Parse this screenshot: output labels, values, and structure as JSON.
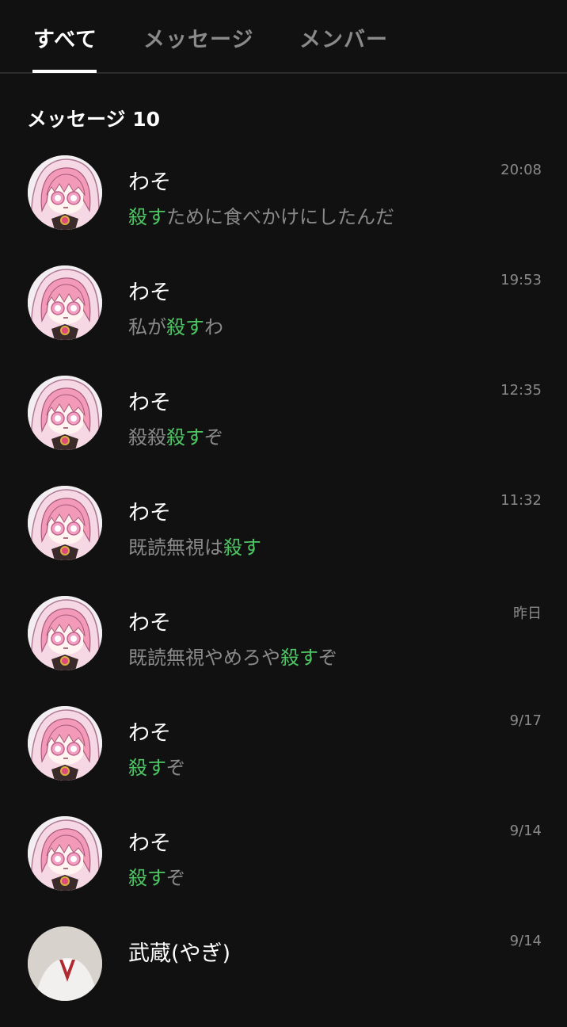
{
  "tabs": [
    {
      "label": "すべて",
      "active": true
    },
    {
      "label": "メッセージ",
      "active": false
    },
    {
      "label": "メンバー",
      "active": false
    }
  ],
  "section": {
    "title": "メッセージ 10"
  },
  "colors": {
    "background": "#111111",
    "highlight": "#4cc764",
    "muted": "#8a8a8a",
    "text": "#ffffff"
  },
  "messages": [
    {
      "name": "わそ",
      "time": "20:08",
      "pre": "",
      "hl": "殺す",
      "post": "ために食べかけにしたんだ",
      "avatar_icon": "pink-hood-character-avatar"
    },
    {
      "name": "わそ",
      "time": "19:53",
      "pre": "私が",
      "hl": "殺す",
      "post": "わ",
      "avatar_icon": "pink-hood-character-avatar"
    },
    {
      "name": "わそ",
      "time": "12:35",
      "pre": "殺殺",
      "hl": "殺す",
      "post": "ぞ",
      "avatar_icon": "pink-hood-character-avatar"
    },
    {
      "name": "わそ",
      "time": "11:32",
      "pre": "既読無視は",
      "hl": "殺す",
      "post": "",
      "avatar_icon": "pink-hood-character-avatar"
    },
    {
      "name": "わそ",
      "time": "昨日",
      "pre": "既読無視やめろや",
      "hl": "殺す",
      "post": "ぞ",
      "avatar_icon": "pink-hood-character-avatar"
    },
    {
      "name": "わそ",
      "time": "9/17",
      "pre": "",
      "hl": "殺す",
      "post": "ぞ",
      "avatar_icon": "pink-hood-character-avatar"
    },
    {
      "name": "わそ",
      "time": "9/14",
      "pre": "",
      "hl": "殺す",
      "post": "ぞ",
      "avatar_icon": "pink-hood-character-avatar"
    },
    {
      "name": "武蔵(やぎ)",
      "time": "9/14",
      "pre": "",
      "hl": "",
      "post": "",
      "avatar_icon": "user-photo-avatar"
    }
  ]
}
